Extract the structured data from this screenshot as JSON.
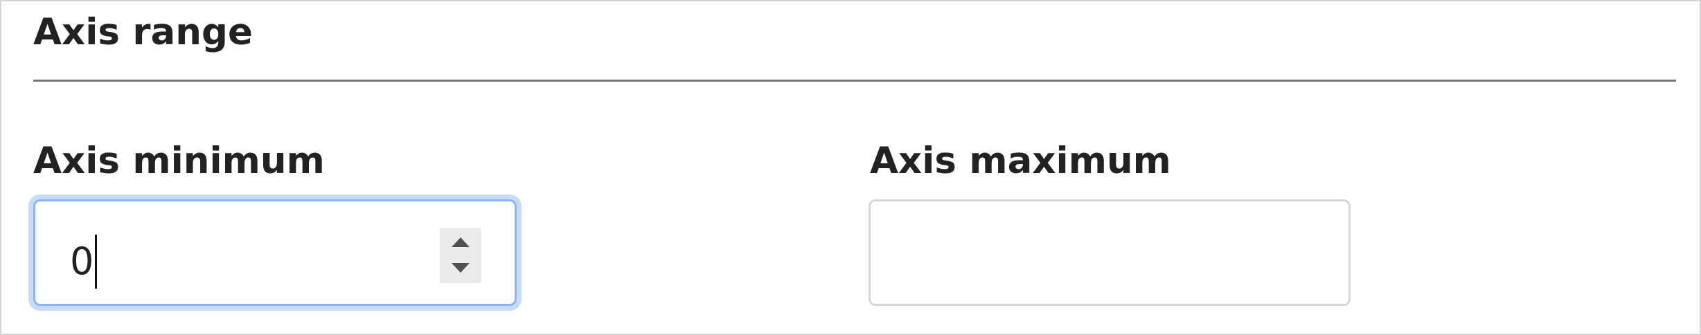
{
  "section": {
    "title": "Axis range"
  },
  "fields": {
    "minimum": {
      "label": "Axis minimum",
      "value": "0",
      "focused": true,
      "control": "number-stepper"
    },
    "maximum": {
      "label": "Axis maximum",
      "value": "",
      "focused": false
    }
  },
  "icons": {
    "increment": "chevron-up-icon",
    "decrement": "chevron-down-icon"
  },
  "colors": {
    "focus_border": "#86b7fe",
    "focus_ring": "#c9dcf7",
    "default_border": "#d6d6d6",
    "divider": "#777777"
  }
}
